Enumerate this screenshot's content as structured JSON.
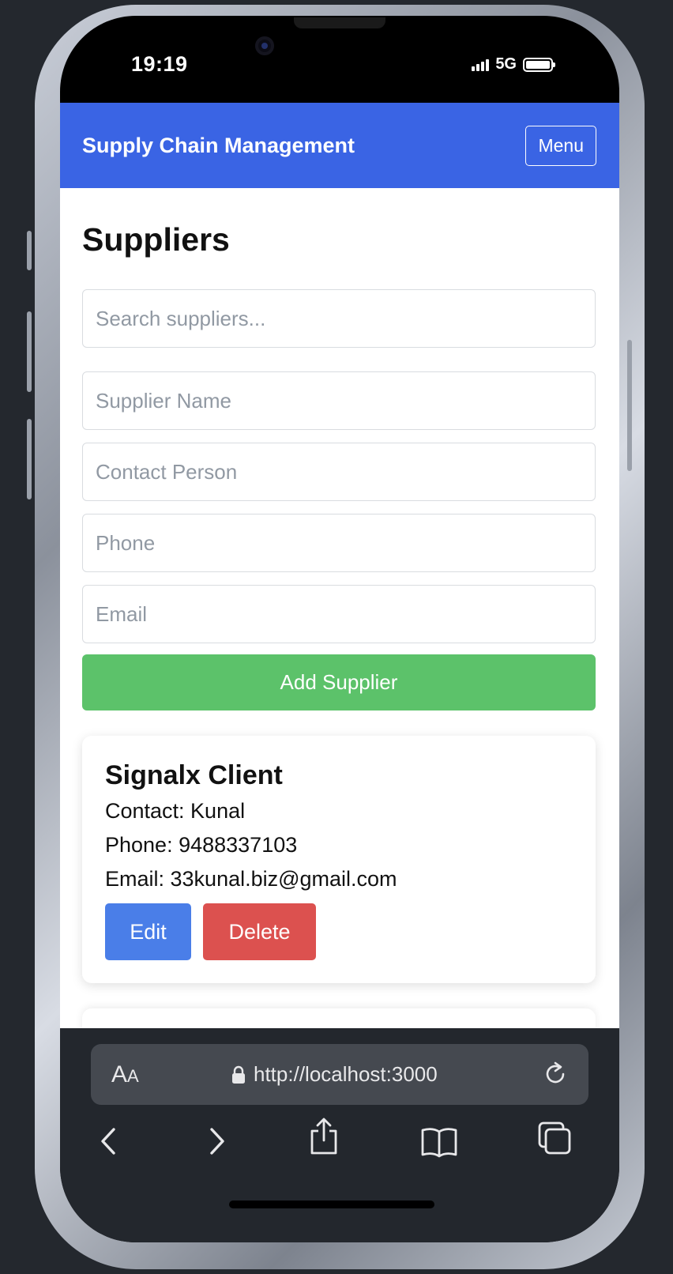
{
  "status_bar": {
    "time": "19:19",
    "network": "5G"
  },
  "navbar": {
    "brand": "Supply Chain Management",
    "menu_label": "Menu"
  },
  "main": {
    "title": "Suppliers",
    "search_placeholder": "Search suppliers...",
    "form": {
      "name_placeholder": "Supplier Name",
      "contact_placeholder": "Contact Person",
      "phone_placeholder": "Phone",
      "email_placeholder": "Email",
      "submit_label": "Add Supplier"
    },
    "suppliers": [
      {
        "name": "Signalx Client",
        "contact": "Contact: Kunal",
        "phone": "Phone: 9488337103",
        "email": "Email: 33kunal.biz@gmail.com",
        "edit_label": "Edit",
        "delete_label": "Delete"
      }
    ]
  },
  "browser": {
    "text_size_label_large": "A",
    "text_size_label_small": "A",
    "url": "http://localhost:3000"
  },
  "colors": {
    "navbar": "#3a64e4",
    "add_button": "#5cc26a",
    "edit_button": "#4a7ee8",
    "delete_button": "#dc514f"
  }
}
